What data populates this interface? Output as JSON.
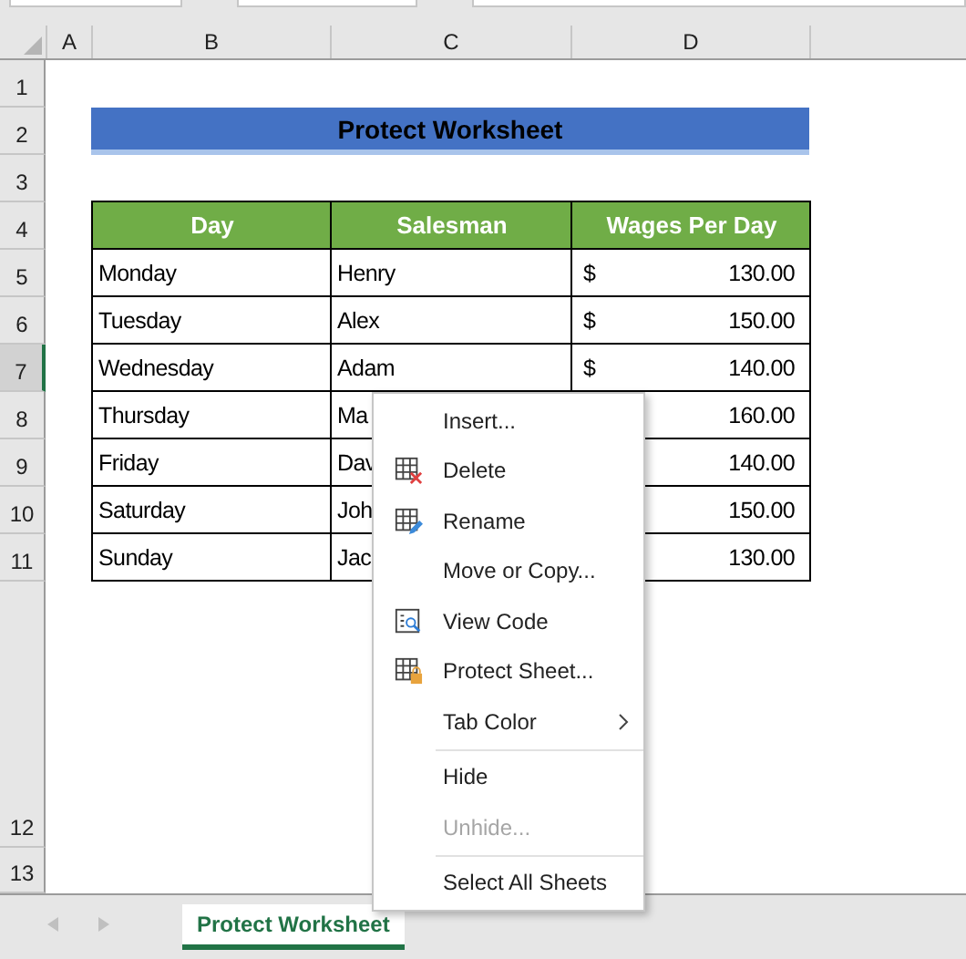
{
  "column_headers": [
    "A",
    "B",
    "C",
    "D"
  ],
  "row_headers": [
    {
      "label": "1",
      "selected": false
    },
    {
      "label": "2",
      "selected": false
    },
    {
      "label": "3",
      "selected": false
    },
    {
      "label": "4",
      "selected": false
    },
    {
      "label": "5",
      "selected": false
    },
    {
      "label": "6",
      "selected": false
    },
    {
      "label": "7",
      "selected": true
    },
    {
      "label": "8",
      "selected": false
    },
    {
      "label": "9",
      "selected": false
    },
    {
      "label": "10",
      "selected": false
    },
    {
      "label": "11",
      "selected": false
    },
    {
      "label": "12",
      "selected": false
    },
    {
      "label": "13",
      "selected": false
    }
  ],
  "title": "Protect Worksheet",
  "table": {
    "columns": [
      "Day",
      "Salesman",
      "Wages Per Day"
    ],
    "rows": [
      {
        "day": "Monday",
        "salesman": "Henry",
        "currency": "$",
        "wage": "130.00"
      },
      {
        "day": "Tuesday",
        "salesman": "Alex",
        "currency": "$",
        "wage": "150.00"
      },
      {
        "day": "Wednesday",
        "salesman": "Adam",
        "currency": "$",
        "wage": "140.00"
      },
      {
        "day": "Thursday",
        "salesman": "Ma",
        "wage": "160.00"
      },
      {
        "day": "Friday",
        "salesman": "Dav",
        "wage": "140.00"
      },
      {
        "day": "Saturday",
        "salesman": "Joh",
        "wage": "150.00"
      },
      {
        "day": "Sunday",
        "salesman": "Jac",
        "wage": "130.00"
      }
    ]
  },
  "context_menu": {
    "items": [
      {
        "kind": "command",
        "label": "Insert...",
        "disabled": false
      },
      {
        "kind": "command",
        "label": "Delete",
        "disabled": false
      },
      {
        "kind": "command",
        "label": "Rename",
        "disabled": false
      },
      {
        "kind": "command",
        "label": "Move or Copy...",
        "disabled": false
      },
      {
        "kind": "command",
        "label": "View Code",
        "disabled": false
      },
      {
        "kind": "command",
        "label": "Protect Sheet...",
        "disabled": false
      },
      {
        "kind": "submenu",
        "label": "Tab Color",
        "disabled": false
      },
      {
        "kind": "separator"
      },
      {
        "kind": "command",
        "label": "Hide",
        "disabled": false
      },
      {
        "kind": "command",
        "label": "Unhide...",
        "disabled": true
      },
      {
        "kind": "separator"
      },
      {
        "kind": "command",
        "label": "Select All Sheets",
        "disabled": false
      }
    ]
  },
  "sheet_tabs": [
    {
      "label": "Protect Worksheet",
      "selected": true
    }
  ]
}
